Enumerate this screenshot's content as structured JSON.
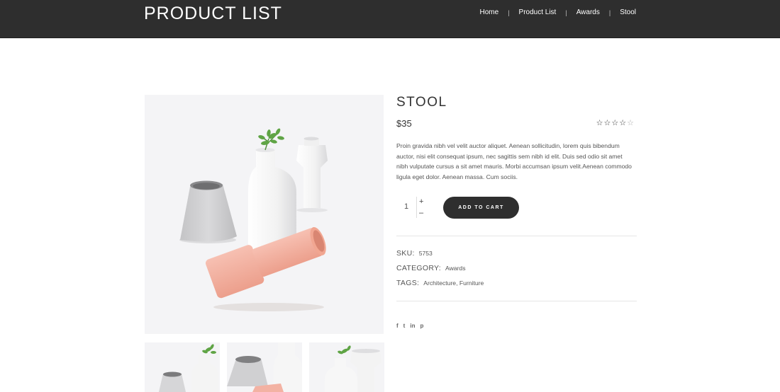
{
  "header": {
    "brand": "PRODUCT LIST",
    "nav": [
      "Home",
      "Product List",
      "Awards",
      "Stool"
    ],
    "separator": "|"
  },
  "product": {
    "title": "STOOL",
    "price": "$35",
    "rating": 4,
    "rating_max": 5,
    "description": "Proin gravida nibh vel velit auctor aliquet. Aenean sollicitudin, lorem quis bibendum auctor, nisi elit consequat ipsum, nec sagittis sem nibh id elit. Duis sed odio sit amet nibh vulputate cursus a sit amet mauris. Morbi accumsan ipsum velit.Aenean commodo ligula eget dolor. Aenean massa. Cum sociis.",
    "quantity": "1",
    "plus": "+",
    "minus": "–",
    "add_to_cart": "ADD TO CART"
  },
  "meta": {
    "sku_label": "SKU:",
    "sku": "5753",
    "category_label": "CATEGORY:",
    "category": "Awards",
    "tags_label": "TAGS:",
    "tags": [
      "Architecture",
      "Furniture"
    ],
    "tags_sep": ", "
  },
  "social": [
    "f",
    "t",
    "in",
    "p"
  ],
  "icons": {
    "social": [
      "facebook-icon",
      "twitter-icon",
      "linkedin-icon",
      "pinterest-icon"
    ],
    "rating": "star-icon"
  },
  "colors": {
    "header_bg": "#2e2e2e",
    "button_bg": "#2e2e2e",
    "vase_pink": "#f3b2a3",
    "vase_grey": "#d8d8da",
    "vase_white": "#f7f7f7"
  }
}
